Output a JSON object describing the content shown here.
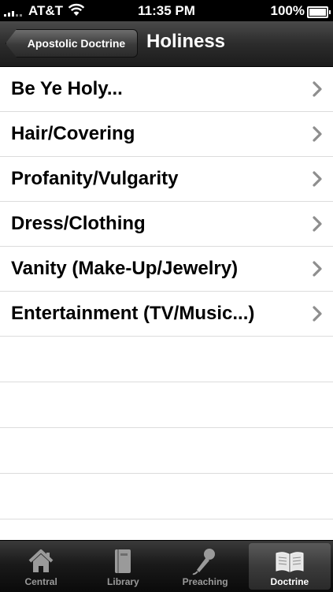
{
  "status_bar": {
    "carrier": "AT&T",
    "time": "11:35 PM",
    "battery": "100%"
  },
  "nav": {
    "back_label": "Apostolic Doctrine",
    "title": "Holiness"
  },
  "list": {
    "items": [
      "Be Ye Holy...",
      "Hair/Covering",
      "Profanity/Vulgarity",
      "Dress/Clothing",
      "Vanity (Make-Up/Jewelry)",
      "Entertainment (TV/Music...)"
    ]
  },
  "tabs": [
    {
      "label": "Central",
      "icon": "home-icon",
      "selected": false
    },
    {
      "label": "Library",
      "icon": "book-icon",
      "selected": false
    },
    {
      "label": "Preaching",
      "icon": "microphone-icon",
      "selected": false
    },
    {
      "label": "Doctrine",
      "icon": "open-book-icon",
      "selected": true
    }
  ],
  "colors": {
    "chevron": "#8e8e8e",
    "separator": "#dcdcdc",
    "tab_inactive": "#9a9a9a",
    "tab_active": "#ffffff"
  }
}
